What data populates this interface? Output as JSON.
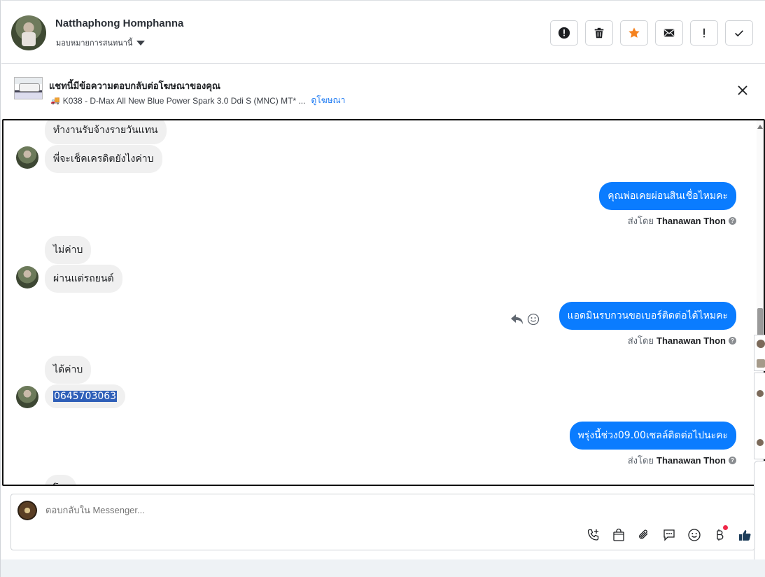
{
  "header": {
    "contact_name": "Natthaphong Homphanna",
    "assign_label": "มอบหมายการสนทนานี้",
    "actions": [
      {
        "name": "spam-button",
        "icon": "alert-circle-icon"
      },
      {
        "name": "delete-button",
        "icon": "trash-icon"
      },
      {
        "name": "star-button",
        "icon": "star-icon"
      },
      {
        "name": "mark-unread-button",
        "icon": "envelope-icon"
      },
      {
        "name": "priority-button",
        "icon": "exclamation-icon"
      },
      {
        "name": "mark-done-button",
        "icon": "check-icon"
      }
    ]
  },
  "ad_banner": {
    "title": "แชทนี้มีข้อความตอบกลับต่อโฆษณาของคุณ",
    "ad_name": "K038 - D-Max All New Blue Power Spark 3.0 Ddi S (MNC) MT* ...",
    "view_ad_link": "ดูโฆษณา"
  },
  "messages": {
    "m1": "ทำงานรับจ้างรายวันแทน",
    "m2": "พี่จะเช็คเครดิตยังไงค่าบ",
    "m3": "คุณพ่อเคยผ่อนสินเชื่อไหมคะ",
    "m4": "ไม่ค่าบ",
    "m5": "ผ่านแต่รถยนต์",
    "m6": "แอดมินรบกวนขอเบอร์ติดต่อได้ไหมคะ",
    "m7": "ได้ค่าบ",
    "m8": "0645703063",
    "m9": "พรุ่งนี้ช่วง09.00เซลล์ติดต่อไปนะคะ",
    "m10": "โ..."
  },
  "sent_by": {
    "prefix": "ส่งโดย",
    "agent": "Thanawan Thon"
  },
  "composer": {
    "placeholder": "ตอบกลับใน Messenger..."
  },
  "colors": {
    "outgoing_bubble": "#0a7cff",
    "incoming_bubble": "#f0f0f0",
    "star": "#f5821f",
    "like": "#1c3d5a"
  }
}
